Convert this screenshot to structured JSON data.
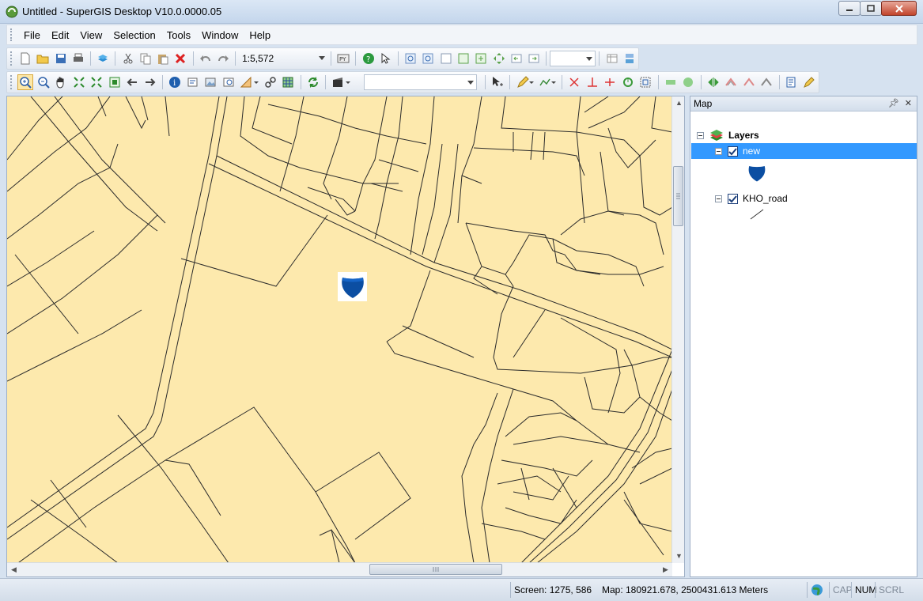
{
  "window": {
    "title": "Untitled - SuperGIS Desktop V10.0.0000.05",
    "controls": [
      "minimize",
      "maximize",
      "close"
    ]
  },
  "menu": [
    "File",
    "Edit",
    "View",
    "Selection",
    "Tools",
    "Window",
    "Help"
  ],
  "toolbar": {
    "scale_value": "1:5,572",
    "icons_row1": [
      "new-icon",
      "open-icon",
      "save-icon",
      "print-icon",
      "add-data-icon",
      "cut-icon",
      "copy-icon",
      "paste-icon",
      "delete-icon",
      "undo-icon",
      "redo-icon"
    ],
    "icons_row1b": [
      "python-icon",
      "help-icon",
      "whats-this-icon"
    ],
    "icons_row1c": [
      "fixed-zoom-in-icon",
      "fixed-zoom-out-icon",
      "zoom-layer-icon",
      "zoom-selected-icon",
      "full-extent-icon",
      "pan-icon",
      "previous-extent-icon",
      "next-extent-icon"
    ],
    "icons_row2": [
      "zoom-in-icon",
      "zoom-out-icon",
      "pan-hand-icon",
      "zoom-to-layer-icon",
      "full-extent-icon",
      "select-icon",
      "back-icon",
      "forward-icon",
      "identify-icon",
      "info-icon",
      "image-icon",
      "find-icon",
      "measure-icon",
      "hyperlink-icon",
      "grid-icon",
      "refresh-icon"
    ]
  },
  "map_panel": {
    "title": "Map",
    "root": "Layers",
    "layers": [
      {
        "name": "new",
        "checked": true,
        "symbol": "shield-icon",
        "selected": true
      },
      {
        "name": "KHO_road",
        "checked": true,
        "symbol": "line-symbol-icon",
        "selected": false
      }
    ]
  },
  "status": {
    "screen": "Screen: 1275, 586",
    "map": "Map: 180921.678, 2500431.613 Meters",
    "cap": "CAP",
    "num": "NUM",
    "scrl": "SCRL"
  },
  "colors": {
    "map_background": "#fde9ad",
    "road_line": "#2b2b2b",
    "shield_blue": "#0b4ea2",
    "selection_blue": "#3399ff"
  }
}
